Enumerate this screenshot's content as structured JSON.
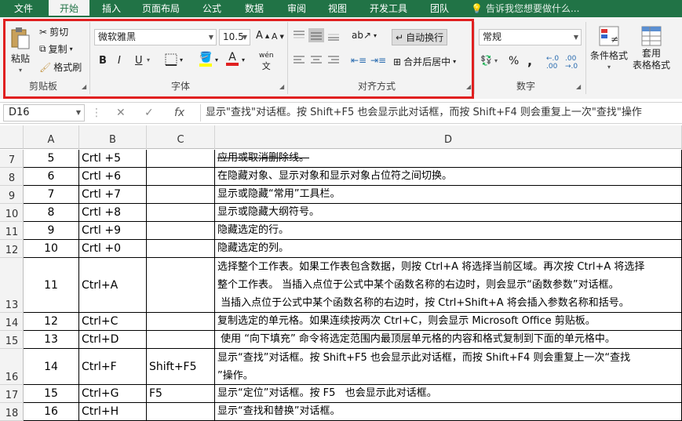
{
  "tabs": {
    "file": "文件",
    "home": "开始",
    "insert": "插入",
    "layout": "页面布局",
    "formulas": "公式",
    "data": "数据",
    "review": "审阅",
    "view": "视图",
    "developer": "开发工具",
    "team": "团队"
  },
  "tell_me": "告诉我您想要做什么...",
  "ribbon": {
    "clipboard": {
      "paste": "粘贴",
      "cut": "剪切",
      "copy": "复制",
      "painter": "格式刷",
      "label": "剪贴板"
    },
    "font": {
      "name": "微软雅黑",
      "size": "10.5",
      "bold": "B",
      "italic": "I",
      "underline": "U",
      "pinyin": "wén",
      "label": "字体"
    },
    "alignment": {
      "wrap": "自动换行",
      "merge": "合并后居中",
      "label": "对齐方式"
    },
    "number": {
      "format": "常规",
      "percent": "%",
      "comma": ",",
      "label": "数字"
    },
    "styles": {
      "conditional_line1": "条件格式",
      "table_line1": "套用",
      "table_line2": "表格格式"
    }
  },
  "colors": {
    "accent": "#217346",
    "highlight_box": "#e02020",
    "font_color": "#e02020",
    "fill_color": "#ffff00"
  },
  "namebox": "D16",
  "formula": "显示\"查找\"对话框。按 Shift+F5 也会显示此对话框，而按 Shift+F4 则会重复上一次\"查找\"操作",
  "columns": [
    "A",
    "B",
    "C",
    "D"
  ],
  "rows": [
    {
      "num": "7",
      "a": "5",
      "b": "Crtl +5",
      "c": "",
      "d": [
        "应用或取消删除线。"
      ]
    },
    {
      "num": "8",
      "a": "6",
      "b": "Crtl +6",
      "c": "",
      "d": [
        "在隐藏对象、显示对象和显示对象占位符之间切换。"
      ]
    },
    {
      "num": "9",
      "a": "7",
      "b": "Crtl +7",
      "c": "",
      "d": [
        "显示或隐藏“常用”工具栏。"
      ]
    },
    {
      "num": "10",
      "a": "8",
      "b": "Crtl +8",
      "c": "",
      "d": [
        "显示或隐藏大纲符号。"
      ]
    },
    {
      "num": "11",
      "a": "9",
      "b": "Crtl +9",
      "c": "",
      "d": [
        "隐藏选定的行。"
      ]
    },
    {
      "num": "12",
      "a": "10",
      "b": "Crtl +0",
      "c": "",
      "d": [
        "隐藏选定的列。"
      ]
    },
    {
      "num": "13",
      "a": "11",
      "b": "Ctrl+A",
      "c": "",
      "d": [
        "选择整个工作表。如果工作表包含数据，则按 Ctrl+A 将选择当前区域。再次按 Ctrl+A 将选择",
        "整个工作表。 当插入点位于公式中某个函数名称的右边时，则会显示“函数参数”对话框。",
        " 当插入点位于公式中某个函数名称的右边时，按 Ctrl+Shift+A 将会插入参数名称和括号。"
      ]
    },
    {
      "num": "14",
      "a": "12",
      "b": "Ctrl+C",
      "c": "",
      "d": [
        "复制选定的单元格。如果连续按两次 Ctrl+C，则会显示 Microsoft Office 剪贴板。"
      ]
    },
    {
      "num": "15",
      "a": "13",
      "b": "Ctrl+D",
      "c": "",
      "d": [
        " 使用 “向下填充” 命令将选定范围内最顶层单元格的内容和格式复制到下面的单元格中。"
      ]
    },
    {
      "num": "16",
      "a": "14",
      "b": "Ctrl+F",
      "c": "Shift+F5",
      "d": [
        "显示“查找”对话框。按 Shift+F5 也会显示此对话框，而按 Shift+F4 则会重复上一次“查找",
        "”操作。"
      ]
    },
    {
      "num": "17",
      "a": "15",
      "b": "Ctrl+G",
      "c": "F5",
      "d": [
        "显示“定位”对话框。按 F5   也会显示此对话框。"
      ]
    },
    {
      "num": "18",
      "a": "16",
      "b": "Ctrl+H",
      "c": "",
      "d": [
        "显示“查找和替换”对话框。"
      ]
    }
  ]
}
